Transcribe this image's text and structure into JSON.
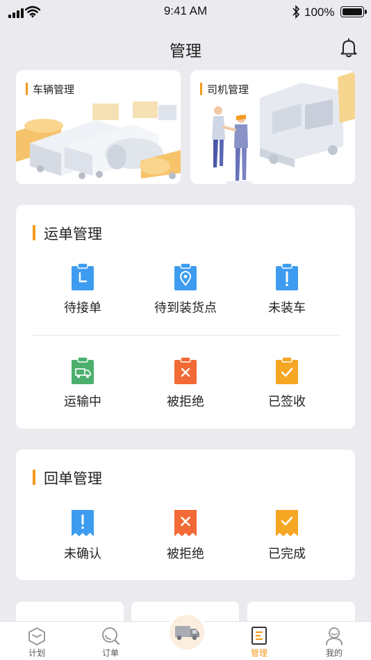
{
  "status_bar": {
    "time": "9:41 AM",
    "battery": "100%"
  },
  "navbar": {
    "title": "管理"
  },
  "top_cards": [
    {
      "label": "车辆管理"
    },
    {
      "label": "司机管理"
    }
  ],
  "waybill": {
    "title": "运单管理",
    "items": [
      {
        "label": "待接单",
        "icon": "clock-clipboard-icon",
        "color": "#3d9cf0"
      },
      {
        "label": "待到装货点",
        "icon": "location-clipboard-icon",
        "color": "#3d9cf0"
      },
      {
        "label": "未装车",
        "icon": "exclamation-clipboard-icon",
        "color": "#3d9cf0"
      },
      {
        "label": "运输中",
        "icon": "truck-clipboard-icon",
        "color": "#4caf6e"
      },
      {
        "label": "被拒绝",
        "icon": "x-clipboard-icon",
        "color": "#f26a35"
      },
      {
        "label": "已签收",
        "icon": "check-clipboard-icon",
        "color": "#f5a623"
      }
    ]
  },
  "receipt": {
    "title": "回单管理",
    "items": [
      {
        "label": "未确认",
        "icon": "exclamation-receipt-icon",
        "color": "#3d9cf0"
      },
      {
        "label": "被拒绝",
        "icon": "x-receipt-icon",
        "color": "#f26a35"
      },
      {
        "label": "已完成",
        "icon": "check-receipt-icon",
        "color": "#f5a623"
      }
    ]
  },
  "tabbar": {
    "tabs": [
      {
        "label": "计划",
        "icon": "plan-icon"
      },
      {
        "label": "订单",
        "icon": "order-search-icon"
      },
      {
        "label": "",
        "icon": "truck-icon"
      },
      {
        "label": "管理",
        "icon": "manage-icon",
        "active": true
      },
      {
        "label": "我的",
        "icon": "profile-icon"
      }
    ],
    "active_color": "#f39a1e"
  }
}
